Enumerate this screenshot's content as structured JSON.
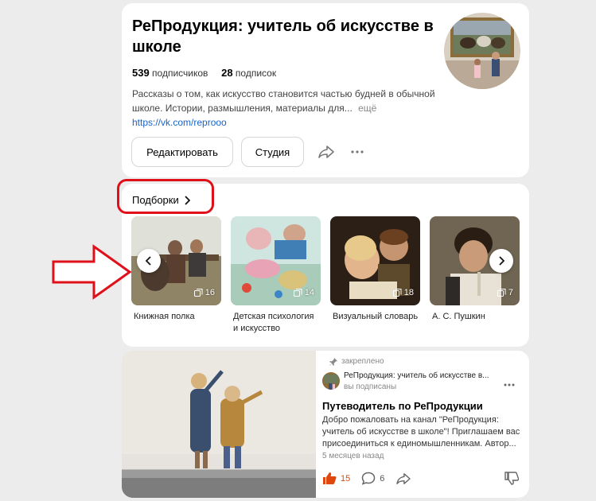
{
  "channel": {
    "title": "РеПродукция: учитель об искусстве в школе",
    "subscribers_count": "539",
    "subscribers_label": "подписчиков",
    "subscriptions_count": "28",
    "subscriptions_label": "подписок",
    "description": "Рассказы о том, как искусство становится частью будней в обычной школе. Истории, размышления, материалы для...",
    "more_label": "ещё",
    "link": "https://vk.com/reprooo",
    "edit_label": "Редактировать",
    "studio_label": "Студия"
  },
  "collections": {
    "title": "Подборки",
    "items": [
      {
        "label": "Книжная полка",
        "count": "16"
      },
      {
        "label": "Детская психология и искусство",
        "count": "14"
      },
      {
        "label": "Визуальный словарь",
        "count": "18"
      },
      {
        "label": "А. С. Пушкин",
        "count": "7"
      }
    ]
  },
  "post": {
    "pinned_label": "закреплено",
    "author": "РеПродукция: учитель об искусстве в...",
    "subscribed_label": "вы подписаны",
    "title": "Путеводитель по РеПродукции",
    "text": "Добро пожаловать на канал \"РеПродукция: учитель об искусстве в школе\"! Приглашаем вас присоединиться к единомышленникам. Автор...",
    "time": "5 месяцев назад",
    "likes": "15",
    "comments": "6"
  },
  "colors": {
    "accent_orange": "#e0470d",
    "link_blue": "#1a63c7",
    "annotation_red": "#e0101a"
  }
}
